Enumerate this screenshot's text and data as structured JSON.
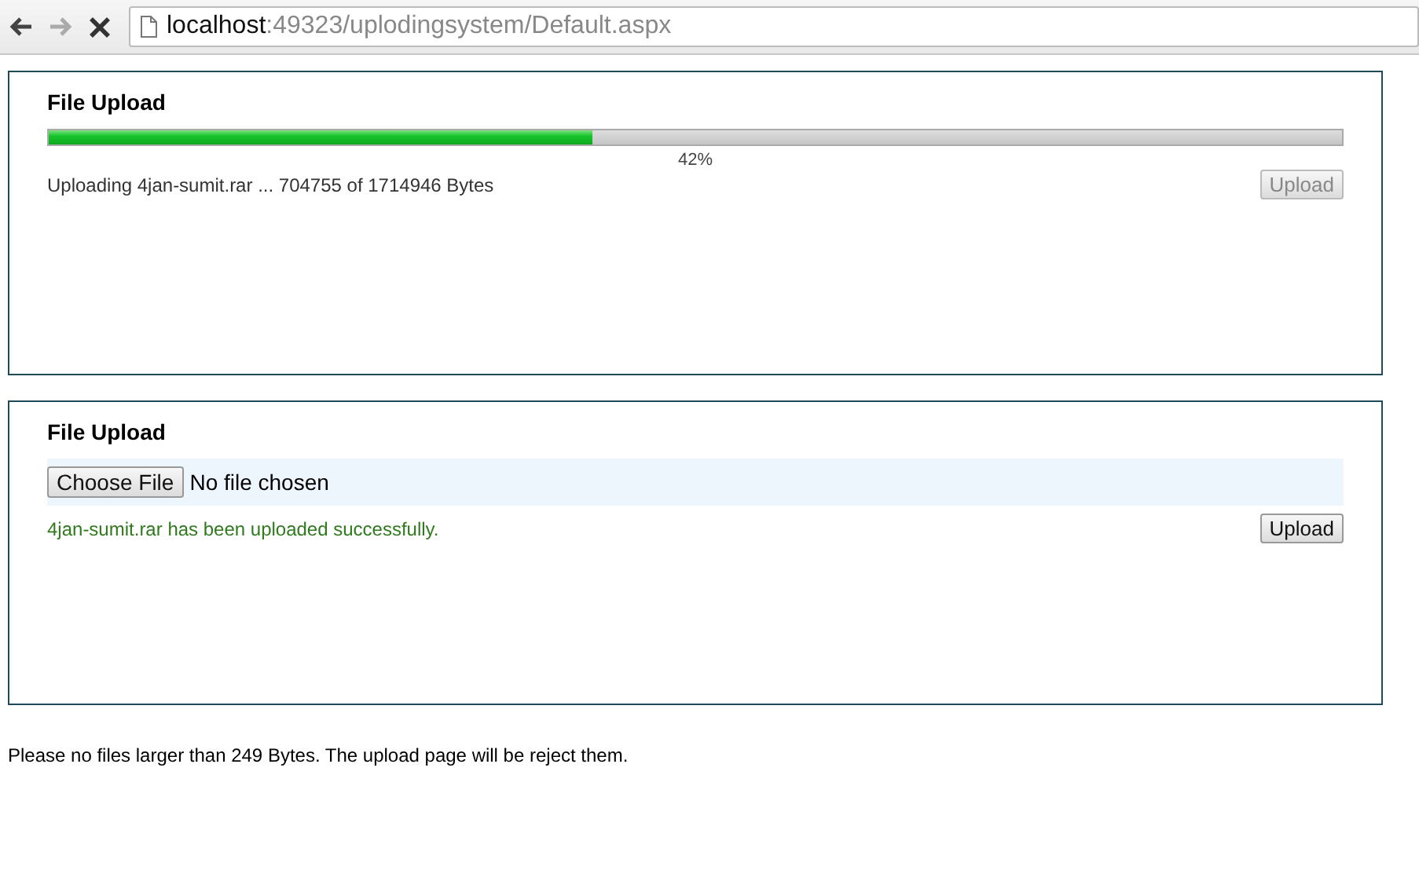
{
  "browser": {
    "back_disabled": false,
    "forward_disabled": true,
    "address_host": "localhost",
    "address_rest": ":49323/uplodingsystem/Default.aspx"
  },
  "panels": [
    {
      "kind": "progress",
      "title": "File Upload",
      "level": 0.42,
      "percent": "42%",
      "status": "Uploading 4jan-sumit.rar ... 704755 of 1714946 Bytes",
      "upload_button": {
        "label": "Upload",
        "disabled": true
      }
    },
    {
      "kind": "chooser",
      "title": "File Upload",
      "choose_button": "Choose File",
      "file_status": "No file chosen",
      "message": "4jan-sumit.rar has been uploaded successfully.",
      "upload_button": {
        "label": "Upload",
        "disabled": false
      }
    }
  ],
  "note": "Please no files larger than 249 Bytes. The upload page will be reject them."
}
